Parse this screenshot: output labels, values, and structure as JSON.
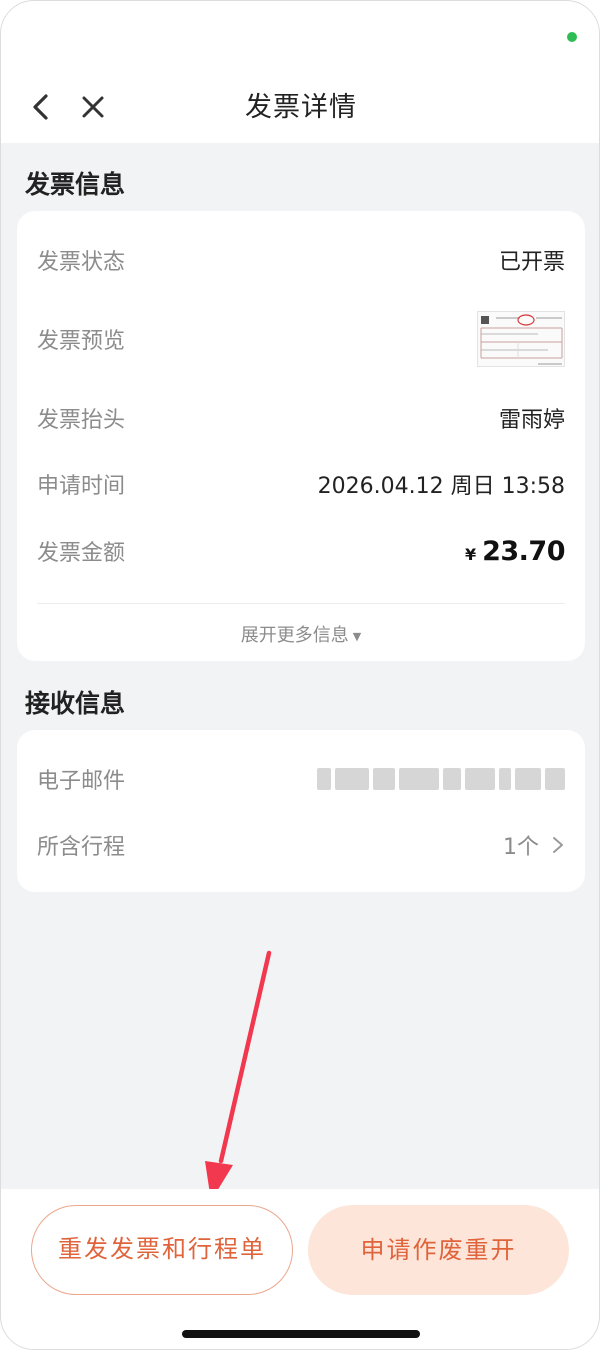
{
  "status_bar": {
    "indicator_color": "#2dbd54"
  },
  "nav": {
    "title": "发票详情",
    "back_icon": "chevron-left-icon",
    "close_icon": "close-icon"
  },
  "invoice_section": {
    "title": "发票信息",
    "rows": [
      {
        "label": "发票状态",
        "value": "已开票"
      },
      {
        "label": "发票预览",
        "value_icon": "invoice-thumbnail"
      },
      {
        "label": "发票抬头",
        "value": "雷雨婷"
      },
      {
        "label": "申请时间",
        "value": "2026.04.12 周日 13:58"
      },
      {
        "label": "发票金额",
        "currency": "¥",
        "amount": "23.70"
      }
    ],
    "expand_label": "展开更多信息",
    "expand_icon": "caret-down-icon"
  },
  "receive_section": {
    "title": "接收信息",
    "rows": [
      {
        "label": "电子邮件",
        "value_redacted": true
      },
      {
        "label": "所含行程",
        "value": "1个",
        "icon": "chevron-right-icon"
      }
    ]
  },
  "actions": {
    "resend_label": "重发发票和行程单",
    "void_label": "申请作废重开"
  },
  "colors": {
    "accent": "#e0643b",
    "accent_soft_bg": "#fde5d9",
    "page_bg": "#f2f3f5",
    "annotation_arrow": "#f2384e"
  }
}
